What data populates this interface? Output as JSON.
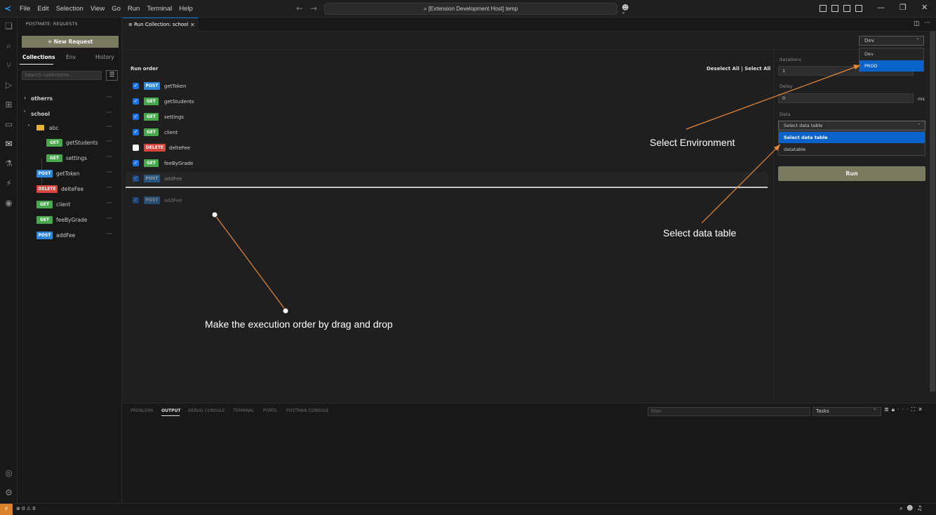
{
  "titlebar": {
    "menu": [
      "File",
      "Edit",
      "Selection",
      "View",
      "Go",
      "Run",
      "Terminal",
      "Help"
    ],
    "command_center": "[Extension Development Host] temp"
  },
  "sidebar": {
    "title": "POSTMATE: REQUESTS",
    "new_request": "New Request",
    "tabs": [
      "Collections",
      "Env",
      "History"
    ],
    "search_placeholder": "Search collections...",
    "tree": [
      {
        "kind": "collection",
        "label": "otherrs"
      },
      {
        "kind": "collection",
        "label": "school"
      },
      {
        "kind": "folder",
        "label": "abc"
      },
      {
        "kind": "request",
        "method": "GET",
        "label": "getStudents"
      },
      {
        "kind": "request",
        "method": "GET",
        "label": "settings"
      },
      {
        "kind": "request",
        "method": "POST",
        "label": "getToken"
      },
      {
        "kind": "request",
        "method": "DELETE",
        "label": "delteFee"
      },
      {
        "kind": "request",
        "method": "GET",
        "label": "client"
      },
      {
        "kind": "request",
        "method": "GET",
        "label": "feeByGrade"
      },
      {
        "kind": "request",
        "method": "POST",
        "label": "addFee"
      }
    ]
  },
  "editor": {
    "tab_label": "Run Collection: school",
    "environment": {
      "selected": "Dev",
      "options": [
        "Dev",
        "PROD"
      ],
      "highlighted": "PROD"
    },
    "run_order_label": "Run order",
    "deselect_all": "Deselect All",
    "separator": "|",
    "select_all": "Select All",
    "requests": [
      {
        "method": "POST",
        "label": "getToken",
        "checked": true
      },
      {
        "method": "GET",
        "label": "getStudents",
        "checked": true
      },
      {
        "method": "GET",
        "label": "settings",
        "checked": true
      },
      {
        "method": "GET",
        "label": "client",
        "checked": true
      },
      {
        "method": "DELETE",
        "label": "delteFee",
        "checked": false
      },
      {
        "method": "GET",
        "label": "feeByGrade",
        "checked": true
      },
      {
        "method": "POST",
        "label": "addFee",
        "checked": true
      }
    ],
    "dragged_request": {
      "method": "POST",
      "label": "addFee",
      "checked": true
    },
    "side": {
      "iterations_label": "Iterations",
      "iterations_value": "1",
      "delay_label": "Delay",
      "delay_value": "0",
      "delay_unit": "ms",
      "data_label": "Data",
      "data_selected": "Select data table",
      "data_options": [
        "Select data table",
        "datatable"
      ],
      "run_label": "Run"
    }
  },
  "panel": {
    "tabs": [
      "PROBLEMS",
      "OUTPUT",
      "DEBUG CONSOLE",
      "TERMINAL",
      "PORTS",
      "POSTMAN CONSOLE"
    ],
    "active_tab": "OUTPUT",
    "filter_placeholder": "Filter",
    "tasks_value": "Tasks"
  },
  "statusbar": {
    "problems": "⊗ 0 ⚠ 0"
  },
  "annotations": {
    "select_environment": "Select Environment",
    "select_data_table": "Select data table",
    "drag_drop": "Make the execution order by drag and drop",
    "arrow_color": "#e8893a"
  },
  "colors": {
    "get": "#49a84e",
    "post": "#2e87d8",
    "delete": "#d9453d",
    "selection_blue": "#0a63c9",
    "button_olive": "#7a7a60"
  }
}
